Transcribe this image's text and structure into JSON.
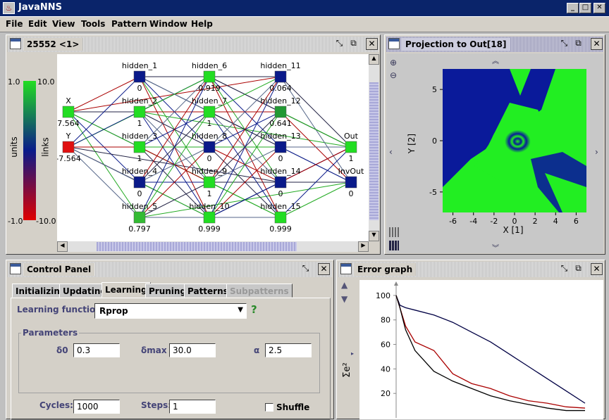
{
  "app": {
    "title": "JavaNNS",
    "icon": "java-cup-icon"
  },
  "window_buttons": {
    "minimize": "_",
    "maximize": "□",
    "close": "✕"
  },
  "menu": [
    "File",
    "Edit",
    "View",
    "Tools",
    "Pattern",
    "Window",
    "Help"
  ],
  "network_frame": {
    "title": "25552 <1>",
    "legend": {
      "units_label": "units",
      "links_label": "links",
      "units_max": "1.0",
      "units_min": "-1.0",
      "links_max": "10.0",
      "links_min": "-10.0"
    },
    "nodes": [
      {
        "name": "X",
        "value": "7.564",
        "color": "#22dd22",
        "col": 0,
        "row": 1
      },
      {
        "name": "Y",
        "value": "-7.564",
        "color": "#e01010",
        "col": 0,
        "row": 2
      },
      {
        "name": "hidden_1",
        "value": "0",
        "color": "#0a1a8a",
        "col": 1,
        "row": 0
      },
      {
        "name": "hidden_2",
        "value": "1",
        "color": "#22dd22",
        "col": 1,
        "row": 1
      },
      {
        "name": "hidden_3",
        "value": "1",
        "color": "#22dd22",
        "col": 1,
        "row": 2
      },
      {
        "name": "hidden_4",
        "value": "0",
        "color": "#0a1a8a",
        "col": 1,
        "row": 3
      },
      {
        "name": "hidden_5",
        "value": "0.797",
        "color": "#33bb33",
        "col": 1,
        "row": 4
      },
      {
        "name": "hidden_6",
        "value": "0.919",
        "color": "#22dd22",
        "col": 2,
        "row": 0
      },
      {
        "name": "hidden_7",
        "value": "1",
        "color": "#22dd22",
        "col": 2,
        "row": 1
      },
      {
        "name": "hidden_8",
        "value": "0",
        "color": "#0a1a8a",
        "col": 2,
        "row": 2
      },
      {
        "name": "hidden_9",
        "value": "1",
        "color": "#22dd22",
        "col": 2,
        "row": 3
      },
      {
        "name": "hidden_10",
        "value": "0.999",
        "color": "#22dd22",
        "col": 2,
        "row": 4
      },
      {
        "name": "hidden_11",
        "value": "0.064",
        "color": "#0a1a8a",
        "col": 3,
        "row": 0
      },
      {
        "name": "hidden_12",
        "value": "0.641",
        "color": "#229933",
        "col": 3,
        "row": 1
      },
      {
        "name": "hidden_13",
        "value": "0",
        "color": "#0a1a8a",
        "col": 3,
        "row": 2
      },
      {
        "name": "hidden_14",
        "value": "0",
        "color": "#0a1a8a",
        "col": 3,
        "row": 3
      },
      {
        "name": "hidden_15",
        "value": "0.999",
        "color": "#22dd22",
        "col": 3,
        "row": 4
      },
      {
        "name": "Out",
        "value": "1",
        "color": "#22dd22",
        "col": 4,
        "row": 2
      },
      {
        "name": "InvOut",
        "value": "0",
        "color": "#0a1a8a",
        "col": 4,
        "row": 3
      }
    ]
  },
  "projection_frame": {
    "title": "Projection to Out[18]",
    "xlabel": "X [1]",
    "ylabel": "Y [2]",
    "xticks": [
      "-6",
      "-4",
      "-2",
      "0",
      "2",
      "4",
      "6"
    ],
    "yticks": [
      "5",
      "0",
      "-5"
    ],
    "colors": {
      "low": "#0a1a9a",
      "high": "#22ee22"
    }
  },
  "control_panel": {
    "title": "Control Panel",
    "tabs": [
      "Initializing",
      "Updating",
      "Learning",
      "Pruning",
      "Patterns",
      "Subpatterns"
    ],
    "selected_tab": "Learning",
    "learning_function_label": "Learning function:",
    "learning_function": "Rprop",
    "help": "?",
    "parameters_label": "Parameters",
    "params": [
      {
        "label": "δ0",
        "value": "0.3"
      },
      {
        "label": "δmax",
        "value": "30.0"
      },
      {
        "label": "α",
        "value": "2.5"
      }
    ],
    "cycles_label": "Cycles:",
    "cycles": "1000",
    "steps_label": "Steps:",
    "steps": "1",
    "shuffle_label": "Shuffle"
  },
  "error_graph": {
    "title": "Error graph",
    "ylabel": "Σe²",
    "yticks": [
      "100",
      "80",
      "60",
      "40",
      "20"
    ]
  },
  "chart_data": {
    "type": "line",
    "title": "Error graph",
    "xlabel": "",
    "ylabel": "Σe²",
    "ylim": [
      0,
      108
    ],
    "series": [
      {
        "color": "#000044",
        "x": [
          0,
          2,
          5,
          10,
          20,
          30,
          40,
          50,
          60,
          70,
          80,
          90,
          100
        ],
        "values": [
          100,
          92,
          90,
          88,
          84,
          78,
          70,
          62,
          52,
          42,
          32,
          22,
          12
        ]
      },
      {
        "color": "#aa0000",
        "x": [
          0,
          2,
          5,
          10,
          20,
          30,
          40,
          50,
          60,
          70,
          80,
          90,
          100
        ],
        "values": [
          100,
          90,
          75,
          62,
          55,
          36,
          28,
          24,
          18,
          14,
          12,
          9,
          8
        ]
      },
      {
        "color": "#000000",
        "x": [
          0,
          2,
          5,
          10,
          20,
          30,
          40,
          50,
          60,
          70,
          80,
          90,
          100
        ],
        "values": [
          100,
          90,
          72,
          55,
          38,
          30,
          24,
          18,
          14,
          11,
          8,
          6,
          6
        ]
      }
    ]
  }
}
